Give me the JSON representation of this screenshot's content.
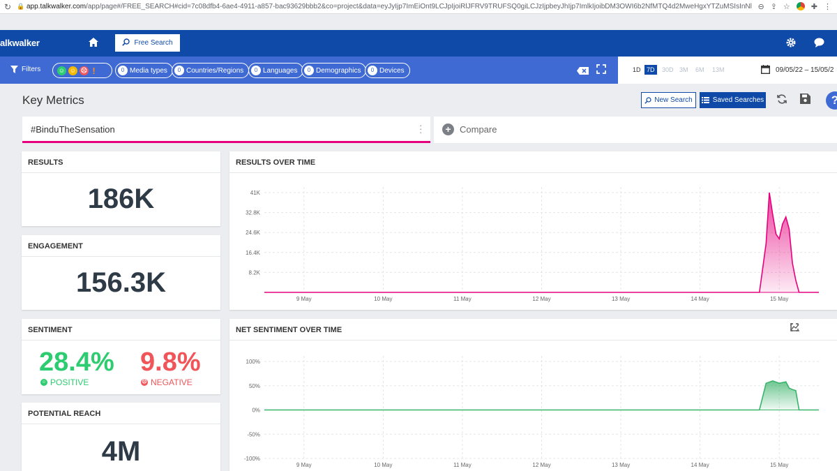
{
  "browser": {
    "url_host": "app.talkwalker.com",
    "url_rest": "/app/page#/FREE_SEARCH#cid=7c08dfb4-6ae4-4911-a857-bac93629bbb2&co=project&data=eyJyIjp7ImEiOnt9LCJpIjoiRlJFRV9TRUFSQ0giLCJzIjpbeyJhIjp7ImlkIjoibDM3OWI6b2NfMTQ4d2MweHgxYTZuMSIsInNlbGVjdGVkV..."
  },
  "topbar": {
    "logo": "alkwalker",
    "free_search_label": "Free Search"
  },
  "filterbar": {
    "filters_label": "Filters",
    "chips": [
      {
        "count": "0",
        "label": "Media types"
      },
      {
        "count": "0",
        "label": "Countries/Regions"
      },
      {
        "count": "0",
        "label": "Languages"
      },
      {
        "count": "0",
        "label": "Demographics"
      },
      {
        "count": "0",
        "label": "Devices"
      }
    ],
    "sentiment_faces": {
      "positive": "☺",
      "neutral": "☺",
      "negative": "☹",
      "unknown": "!"
    },
    "ranges": [
      "1D",
      "7D",
      "30D",
      "3M",
      "6M",
      "13M"
    ],
    "active_range": "7D",
    "date_range": "09/05/22 – 15/05/2"
  },
  "header": {
    "title": "Key Metrics",
    "new_search_label": "New Search",
    "saved_searches_label": "Saved Searches",
    "help_label": "?"
  },
  "query": {
    "text": "#BinduTheSensation",
    "compare_label": "Compare"
  },
  "metrics": {
    "results": {
      "title": "RESULTS",
      "value": "186K"
    },
    "engagement": {
      "title": "ENGAGEMENT",
      "value": "156.3K"
    },
    "sentiment": {
      "title": "SENTIMENT",
      "positive_value": "28.4%",
      "positive_label": "POSITIVE",
      "negative_value": "9.8%",
      "negative_label": "NEGATIVE"
    },
    "potential_reach": {
      "title": "POTENTIAL REACH",
      "value": "4M"
    }
  },
  "colors": {
    "brand_blue": "#0f4aa8",
    "filter_blue": "#3f6ad4",
    "accent_pink": "#e6007e",
    "positive_green": "#2ecc71",
    "negative_red": "#f0555a"
  },
  "chart_data": [
    {
      "type": "area",
      "title": "RESULTS OVER TIME",
      "x_tick_labels": [
        "9 May",
        "10 May",
        "11 May",
        "12 May",
        "13 May",
        "14 May",
        "15 May"
      ],
      "y_tick_labels": [
        "8.2K",
        "16.4K",
        "24.6K",
        "32.8K",
        "41K"
      ],
      "ylim": [
        0,
        41000
      ],
      "color": "#e6007e",
      "x": [
        "2022-05-09",
        "2022-05-15 06:00",
        "2022-05-15 08:00",
        "2022-05-15 09:00",
        "2022-05-15 10:00",
        "2022-05-15 11:00",
        "2022-05-15 12:00",
        "2022-05-15 13:00",
        "2022-05-15 14:00",
        "2022-05-15 15:00",
        "2022-05-15 16:00",
        "2022-05-15 17:00",
        "2022-05-15 18:00",
        "2022-05-15 19:00",
        "2022-05-15 20:00",
        "2022-05-15 22:00",
        "2022-05-16"
      ],
      "values": [
        0,
        0,
        20000,
        41000,
        32000,
        24000,
        22000,
        28000,
        31000,
        26000,
        12000,
        5000,
        0,
        0,
        0,
        0,
        0
      ]
    },
    {
      "type": "area",
      "title": "NET SENTIMENT OVER TIME",
      "x_tick_labels": [
        "9 May",
        "10 May",
        "11 May",
        "12 May",
        "13 May",
        "14 May",
        "15 May"
      ],
      "y_tick_labels": [
        "100%",
        "50%",
        "0%",
        "-50%",
        "-100%"
      ],
      "ylim": [
        -100,
        100
      ],
      "color": "#3ab36a",
      "x": [
        "2022-05-09",
        "2022-05-15 06:00",
        "2022-05-15 08:00",
        "2022-05-15 10:00",
        "2022-05-15 12:00",
        "2022-05-15 14:00",
        "2022-05-15 15:00",
        "2022-05-15 16:00",
        "2022-05-15 17:00",
        "2022-05-15 18:00",
        "2022-05-15 19:00",
        "2022-05-16"
      ],
      "values": [
        0,
        0,
        55,
        60,
        55,
        58,
        45,
        42,
        40,
        0,
        0,
        0
      ]
    }
  ]
}
